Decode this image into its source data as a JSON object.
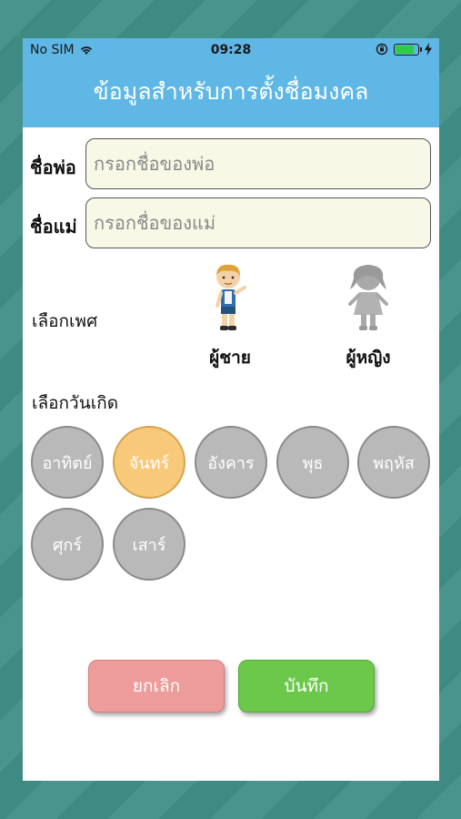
{
  "status": {
    "carrier": "No SIM",
    "time": "09:28",
    "battery_level": 0.85,
    "battery_color": "#2ecc40"
  },
  "header": {
    "title": "ข้อมูลสำหรับการตั้งชื่อมงคล"
  },
  "form": {
    "father_label": "ชื่อพ่อ",
    "father_placeholder": "กรอกชื่อของพ่อ",
    "father_value": "",
    "mother_label": "ชื่อแม่",
    "mother_placeholder": "กรอกชื่อของแม่",
    "mother_value": ""
  },
  "gender": {
    "label": "เลือกเพศ",
    "options": [
      {
        "name": "ผู้ชาย",
        "icon": "boy-icon"
      },
      {
        "name": "ผู้หญิง",
        "icon": "girl-icon"
      }
    ]
  },
  "birthday": {
    "label": "เลือกวันเกิด",
    "days": [
      "อาทิตย์",
      "จันทร์",
      "อังคาร",
      "พุธ",
      "พฤหัส",
      "ศุกร์",
      "เสาร์"
    ],
    "selected": "จันทร์"
  },
  "buttons": {
    "cancel": "ยกเลิก",
    "save": "บันทึก"
  },
  "colors": {
    "header": "#5fb7e6",
    "selected_day": "#f9c97a",
    "day_default": "#b9b9b9",
    "cancel": "#ee9c9b",
    "save": "#6cc84a",
    "background": "#3f8f87"
  }
}
